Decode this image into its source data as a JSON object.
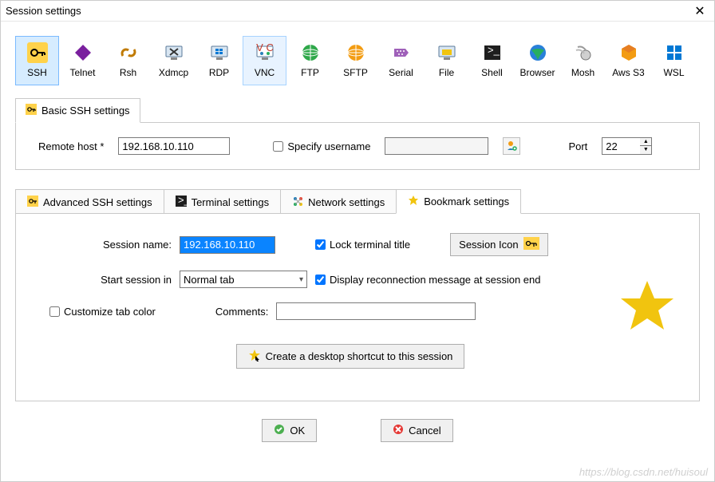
{
  "window": {
    "title": "Session settings"
  },
  "sessionTypes": [
    {
      "key": "ssh",
      "label": "SSH"
    },
    {
      "key": "telnet",
      "label": "Telnet"
    },
    {
      "key": "rsh",
      "label": "Rsh"
    },
    {
      "key": "xdmcp",
      "label": "Xdmcp"
    },
    {
      "key": "rdp",
      "label": "RDP"
    },
    {
      "key": "vnc",
      "label": "VNC"
    },
    {
      "key": "ftp",
      "label": "FTP"
    },
    {
      "key": "sftp",
      "label": "SFTP"
    },
    {
      "key": "serial",
      "label": "Serial"
    },
    {
      "key": "file",
      "label": "File"
    },
    {
      "key": "shell",
      "label": "Shell"
    },
    {
      "key": "browser",
      "label": "Browser"
    },
    {
      "key": "mosh",
      "label": "Mosh"
    },
    {
      "key": "awss3",
      "label": "Aws S3"
    },
    {
      "key": "wsl",
      "label": "WSL"
    }
  ],
  "basicTab": {
    "title": "Basic SSH settings"
  },
  "basic": {
    "remoteHostLabel": "Remote host *",
    "remoteHostValue": "192.168.10.110",
    "specifyUsernameLabel": "Specify username",
    "specifyUsernameChecked": false,
    "usernameValue": "",
    "portLabel": "Port",
    "portValue": "22"
  },
  "advTabs": {
    "ssh": "Advanced SSH settings",
    "terminal": "Terminal settings",
    "network": "Network settings",
    "bookmark": "Bookmark settings"
  },
  "bookmark": {
    "sessionNameLabel": "Session name:",
    "sessionNameValue": "192.168.10.110",
    "lockTitleLabel": "Lock terminal title",
    "lockTitleChecked": true,
    "sessionIconLabel": "Session Icon",
    "startSessionInLabel": "Start session in",
    "startSessionInValue": "Normal tab",
    "reconnMsgLabel": "Display reconnection message at session end",
    "reconnMsgChecked": true,
    "customizeTabColorLabel": "Customize tab color",
    "customizeTabColorChecked": false,
    "commentsLabel": "Comments:",
    "commentsValue": "",
    "desktopShortcutLabel": "Create a desktop shortcut to this session"
  },
  "buttons": {
    "ok": "OK",
    "cancel": "Cancel"
  },
  "watermark": "https://blog.csdn.net/huisoul"
}
